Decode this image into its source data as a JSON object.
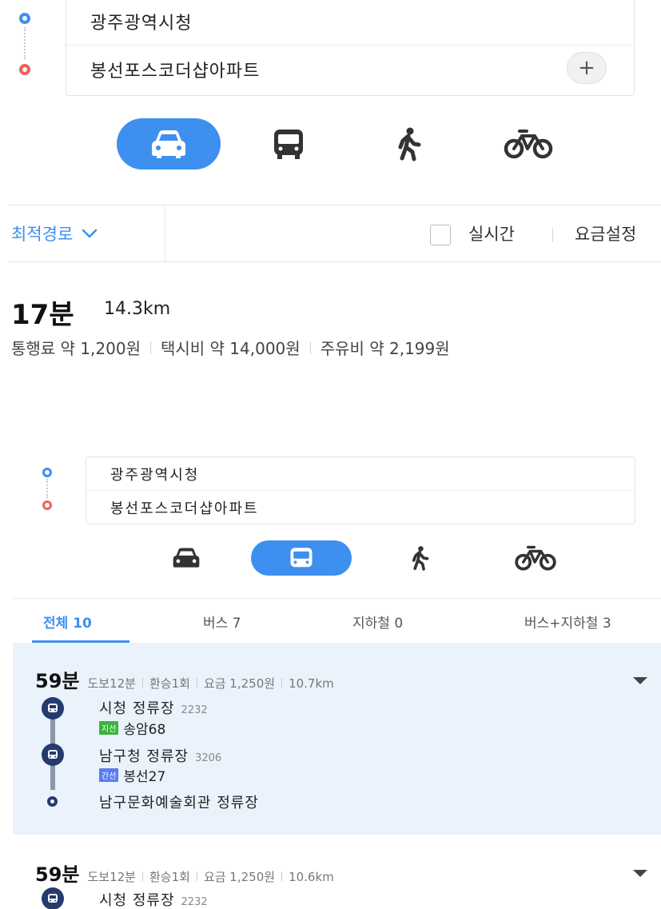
{
  "car_panel": {
    "origin": "광주광역시청",
    "destination": "봉선포스코더샵아파트",
    "add_label": "+",
    "modes": [
      {
        "name": "car-icon",
        "active": true
      },
      {
        "name": "bus-icon",
        "active": false
      },
      {
        "name": "walk-icon",
        "active": false
      },
      {
        "name": "bike-icon",
        "active": false
      }
    ],
    "sort_label": "최적경로",
    "realtime_label": "실시간",
    "fee_setting_label": "요금설정",
    "summary": {
      "time": "17분",
      "distance": "14.3km",
      "toll": "통행료 약 1,200원",
      "taxi": "택시비 약 14,000원",
      "fuel": "주유비 약 2,199원"
    }
  },
  "transit_panel": {
    "origin": "광주광역시청",
    "destination": "봉선포스코더샵아파트",
    "tabs": [
      {
        "label": "전체 10",
        "active": true
      },
      {
        "label": "버스 7",
        "active": false
      },
      {
        "label": "지하철 0",
        "active": false
      },
      {
        "label": "버스+지하철 3",
        "active": false
      }
    ],
    "routes": [
      {
        "time": "59분",
        "walk": "도보12분",
        "transfers": "환승1회",
        "fare": "요금 1,250원",
        "distance": "10.7km",
        "stops": [
          {
            "name": "시청 정류장",
            "code": "2232",
            "badge": "지선",
            "line": "송암68"
          },
          {
            "name": "남구청 정류장",
            "code": "3206",
            "badge": "간선",
            "line": "봉선27"
          },
          {
            "name": "남구문화예술회관 정류장"
          }
        ]
      },
      {
        "time": "59분",
        "walk": "도보12분",
        "transfers": "환승1회",
        "fare": "요금 1,250원",
        "distance": "10.6km",
        "stops": [
          {
            "name": "시청 정류장",
            "code": "2232"
          }
        ]
      }
    ]
  },
  "colors": {
    "accent": "#3d8ff0",
    "origin_pin": "#3d8ff0",
    "dest_pin": "#f0605d",
    "badge_jiseon": "#3cb33c",
    "badge_ganseon": "#5a7cf0",
    "route_icon": "#253b6e",
    "selected_card_bg": "#eaf3fb"
  }
}
